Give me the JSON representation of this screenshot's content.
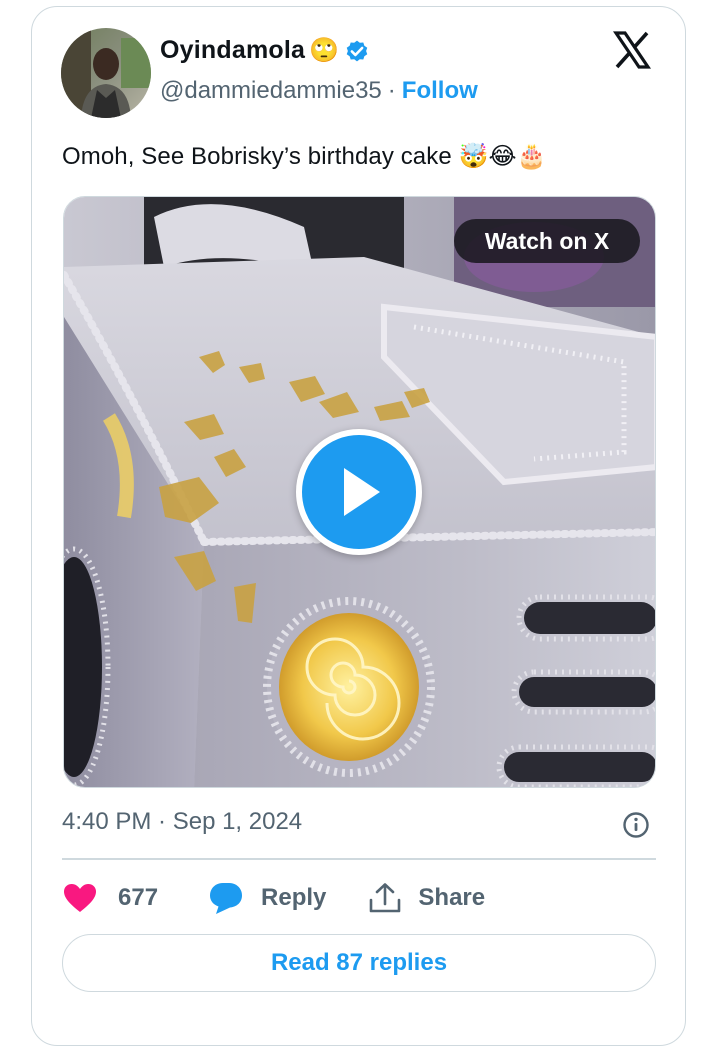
{
  "user": {
    "display_name": "Oyindamola",
    "name_emoji": "🙄",
    "handle": "@dammiedammie35",
    "separator": "·",
    "follow_label": "Follow",
    "verified_color": "#1d9bf0"
  },
  "tweet": {
    "text": "Omoh, See Bobrisky’s birthday cake 🤯😂🎂"
  },
  "media": {
    "watch_label": "Watch on X",
    "play_icon": "play-icon"
  },
  "meta": {
    "timestamp": "4:40 PM · Sep 1, 2024"
  },
  "actions": {
    "likes": "677",
    "reply_label": "Reply",
    "share_label": "Share"
  },
  "read_replies_label": "Read 87 replies",
  "colors": {
    "accent": "#1d9bf0",
    "like": "#f91880",
    "secondary_text": "#536471",
    "border": "#cfd9de"
  }
}
